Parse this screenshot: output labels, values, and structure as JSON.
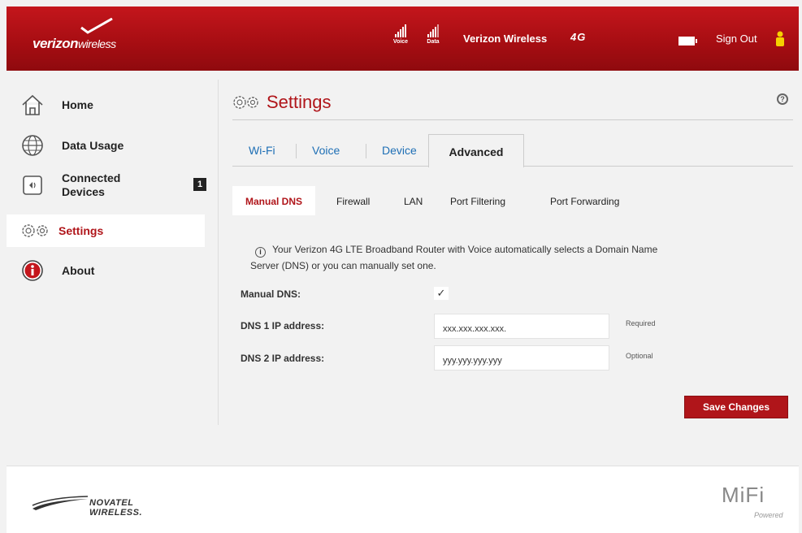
{
  "header": {
    "brand_bold": "verizon",
    "brand_light": "wireless",
    "voice_label": "Voice",
    "data_label": "Data",
    "carrier": "Verizon Wireless",
    "network": "4G",
    "sign_out": "Sign Out"
  },
  "sidebar": {
    "items": [
      {
        "label": "Home",
        "icon": "home-icon"
      },
      {
        "label": "Data Usage",
        "icon": "globe-icon"
      },
      {
        "label_line1": "Connected",
        "label_line2": "Devices",
        "icon": "device-icon",
        "badge": "1"
      },
      {
        "label": "Settings",
        "icon": "gears-icon"
      },
      {
        "label": "About",
        "icon": "info-icon"
      }
    ]
  },
  "main": {
    "title": "Settings",
    "help": "?",
    "tabs": [
      {
        "label": "Wi-Fi"
      },
      {
        "label": "Voice"
      },
      {
        "label": "Device"
      },
      {
        "label": "Advanced",
        "active": true
      }
    ],
    "subtabs": [
      {
        "label": "Manual DNS",
        "active": true
      },
      {
        "label": "Firewall"
      },
      {
        "label": "LAN"
      },
      {
        "label": "Port Filtering"
      },
      {
        "label": "Port Forwarding"
      }
    ],
    "info_line1": "Your Verizon 4G LTE Broadband Router with Voice automatically selects a Domain Name",
    "info_line2": "Server (DNS) or you can manually set one.",
    "form": {
      "manual_dns_label": "Manual DNS:",
      "manual_dns_checked": "✓",
      "dns1_label": "DNS 1 IP address:",
      "dns1_value": "xxx.xxx.xxx.xxx.",
      "dns1_hint": "Required",
      "dns2_label": "DNS 2 IP address:",
      "dns2_value": "yyy.yyy.yyy.yyy",
      "dns2_hint": "Optional"
    },
    "save_label": "Save Changes"
  },
  "footer": {
    "novatel": "NOVATEL WIRELESS.",
    "mifi": "MiFi",
    "powered": "Powered"
  },
  "colors": {
    "accent": "#b0151a",
    "header": "#a50d12",
    "link": "#1e6fb5"
  }
}
